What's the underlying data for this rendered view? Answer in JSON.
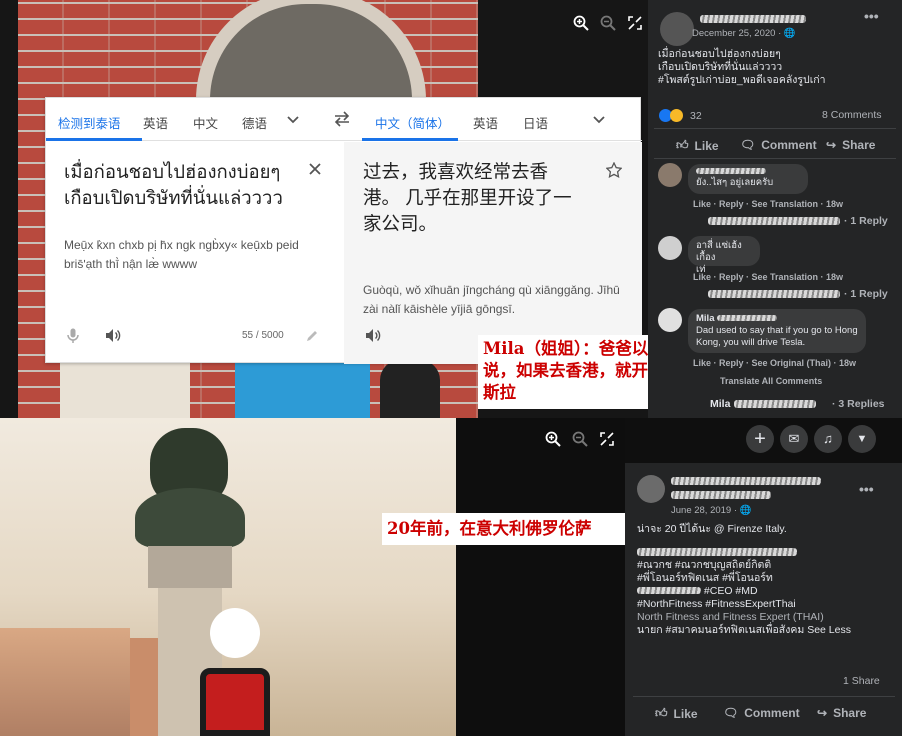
{
  "translator": {
    "src_tabs": [
      "检测到泰语",
      "英语",
      "中文",
      "德语"
    ],
    "dst_tabs": [
      "中文（简体）",
      "英语",
      "日语"
    ],
    "source_text": "เมื่อก่อนชอบไปฮ่องกงบ่อยๆ เกือบเปิดบริษัทที่นั่นแล่วววว",
    "source_romanization": "Meụ̄x k̀xn chxb pị h̄x ngk ngb̀xy« keụ̄xb peid bris̄ʹạth thī̀ nận læ̀ wwww",
    "char_count": "55 / 5000",
    "translated_text": "过去，我喜欢经常去香港。 几乎在那里开设了一家公司。",
    "translated_romanization": "Guòqù, wǒ xǐhuān jīngcháng qù xiānggǎng. Jīhū zài nàlǐ kāishèle yījiā gōngsī."
  },
  "captions": {
    "mila_caption": "Mila（姐姐）：爸爸以前说，如果去香港，就开特斯拉",
    "photo_caption": "20年前，在意大利佛罗伦萨"
  },
  "post1": {
    "date": "December 25, 2020 · ",
    "text_line1": "เมื่อก่อนชอบไปฮ่องกงบ่อยๆ",
    "text_line2": "เกือบเปิดบริษัทที่นั่นแล่วววว",
    "text_line3": "#โพสต์รูปเก่าบ่อย_พอดีเจอคลังรูปเก่า",
    "reaction_count": "32",
    "comments_count": "8 Comments",
    "actions": {
      "like": "Like",
      "comment": "Comment",
      "share": "Share"
    },
    "comments": [
      {
        "text": "ยัง..ไสๆ อยู่เลยครับ",
        "meta": "Like · Reply · See Translation · 18w",
        "replies": "· 1 Reply"
      },
      {
        "text": "อาสี่ แซ่เฮ้ง เกื้อง\nเท่",
        "meta": "Like · Reply · See Translation · 18w",
        "replies": "· 1 Reply"
      },
      {
        "name": "Mila",
        "text": "Dad used to say that if you go to Hong Kong, you will drive Tesla.",
        "meta": "Like · Reply · See Original (Thai) · 18w",
        "replies": "· 3 Replies"
      }
    ],
    "translate_all": "Translate All Comments",
    "mila_reply_name": "Mila"
  },
  "post2": {
    "date": "June 28, 2019 · ",
    "line1": "น่าจะ 20 ปีได้นะ @ Firenze Italy.",
    "hashtags": [
      "#ณวกช #ณวกชบุญสถิตย์กิตติ",
      "#พี่โอนอร์ทฟิตเนส #พี่โอนอร์ท",
      "#CEO #MD",
      "#NorthFitness #FitnessExpertThai"
    ],
    "line_company": "North Fitness and Fitness Expert (THAI)",
    "line_title": "นายก #สมาคมนอร์ทฟิตเนสเพื่อสังคม See Less",
    "shares": "1 Share",
    "actions": {
      "like": "Like",
      "comment": "Comment",
      "share": "Share"
    }
  },
  "colors": {
    "accent_blue": "#1a73e8",
    "fb_dark": "#242526",
    "caption_red": "#cc0000"
  },
  "icons": [
    "zoom-in-icon",
    "zoom-out-icon",
    "fullscreen-icon",
    "swap-icon",
    "close-icon",
    "star-icon",
    "mic-icon",
    "speaker-icon",
    "copy-icon",
    "edit-icon",
    "share-icon",
    "plus-icon",
    "messenger-icon",
    "bell-icon",
    "chevron-down-icon"
  ]
}
